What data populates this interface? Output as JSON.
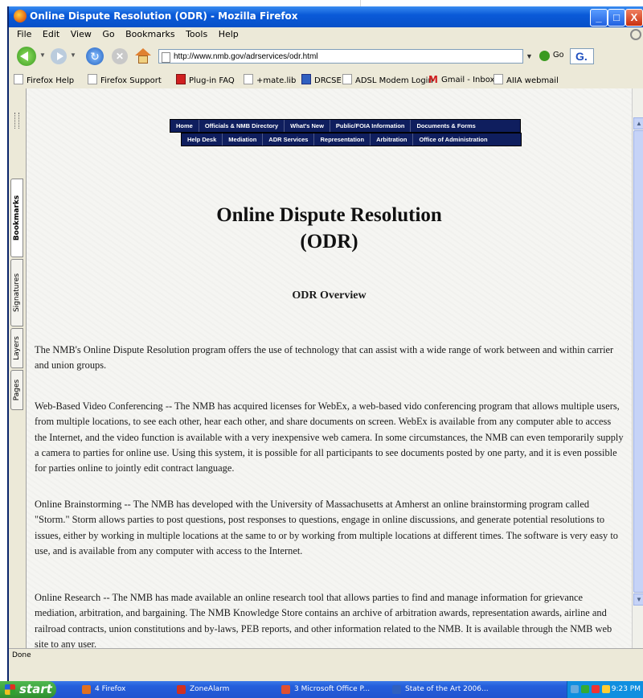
{
  "window": {
    "title": "Online Dispute Resolution (ODR) - Mozilla Firefox"
  },
  "menu": [
    "File",
    "Edit",
    "View",
    "Go",
    "Bookmarks",
    "Tools",
    "Help"
  ],
  "navbar": {
    "url": "http://www.nmb.gov/adrservices/odr.html",
    "go_label": "Go",
    "search_glyph": "G."
  },
  "bookmarks": [
    "Firefox Help",
    "Firefox Support",
    "Plug-in FAQ",
    "+mate.lib",
    "DRCSE",
    "ADSL Modem Login",
    "Gmail - Inbox",
    "AIIA webmail"
  ],
  "sidebar_tabs": [
    "Bookmarks",
    "Signatures",
    "Layers",
    "Pages"
  ],
  "site_nav": {
    "row1": [
      "Home",
      "Officials & NMB Directory",
      "What's New",
      "Public/FOIA Information",
      "Documents & Forms"
    ],
    "row2": [
      "Help Desk",
      "Mediation",
      "ADR Services",
      "Representation",
      "Arbitration",
      "Office of Administration"
    ]
  },
  "page": {
    "title_line1": "Online Dispute Resolution",
    "title_line2": "(ODR)",
    "subtitle": "ODR Overview",
    "p1": "The NMB's Online Dispute Resolution program offers the use of technology that can assist with a wide range of work between and within carrier and union groups.",
    "p2": "Web-Based Video Conferencing -- The NMB has acquired licenses for WebEx, a web-based vido conferencing program that allows multiple users, from multiple locations, to see each other, hear each other, and share documents on screen. WebEx is available from any computer able to access the Internet, and the video function is available with a very inexpensive web camera. In some circumstances, the NMB can even temporarily supply a camera to parties for online use. Using this system, it is possible for all participants to see documents posted by one party, and it is even possible for parties online to jointly edit contract language.",
    "p3": "Online Brainstorming -- The NMB has developed with the University of Massachusetts at Amherst an online brainstorming program called \"Storm.\" Storm allows parties to post questions, post responses to questions, engage in online discussions, and generate potential resolutions to issues, either by working in multiple locations at the same to or by working from multiple locations at different times. The software is very easy to use, and is available from any computer with access to the Internet.",
    "p4": "Online Research -- The NMB has made available an online research tool that allows parties to find and manage information for grievance mediation, arbitration, and bargaining. The NMB Knowledge Store contains an archive of arbitration awards, representation awards, airline and railroad contracts, union constitutions and by-laws, PEB reports, and other information related to the NMB. It is available through the NMB web site to any user."
  },
  "status": "Done",
  "taskbar": {
    "start": "start",
    "tasks": [
      "4 Firefox",
      "ZoneAlarm",
      "3 Microsoft Office P...",
      "State of the Art 2006..."
    ],
    "clock": "9:23 PM"
  },
  "colors": {
    "site_nav_bg": "#0f1e5e",
    "titlebar": "#0a5ad8",
    "taskbar": "#245edb"
  }
}
